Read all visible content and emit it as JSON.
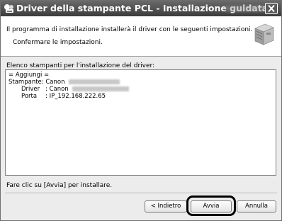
{
  "window": {
    "title": "Driver della stampante PCL - Installazione guidata"
  },
  "header": {
    "line1": "Il programma di installazione installerà il driver con le seguenti impostazioni.",
    "line2": "Confermare le impostazioni."
  },
  "list": {
    "label": "Elenco stampanti per l'installazione del driver:",
    "group": "= Aggiungi =",
    "printer_label": "Stampante: Canon",
    "driver_label": "Driver",
    "driver_value": ": Canon",
    "port_label": "Porta",
    "port_value": ": IP_192.168.222.65"
  },
  "footer": {
    "instruction": "Fare clic su [Avvia] per installare."
  },
  "buttons": {
    "back": "< Indietro",
    "start": "Avvia",
    "cancel": "Annulla"
  },
  "colors": {
    "titlebar": "#4a4a4a",
    "dialog_bg": "#ececec",
    "highlight": "#000000"
  },
  "icons": [
    "printer-driver-icon",
    "printer-icon",
    "close-icon"
  ]
}
